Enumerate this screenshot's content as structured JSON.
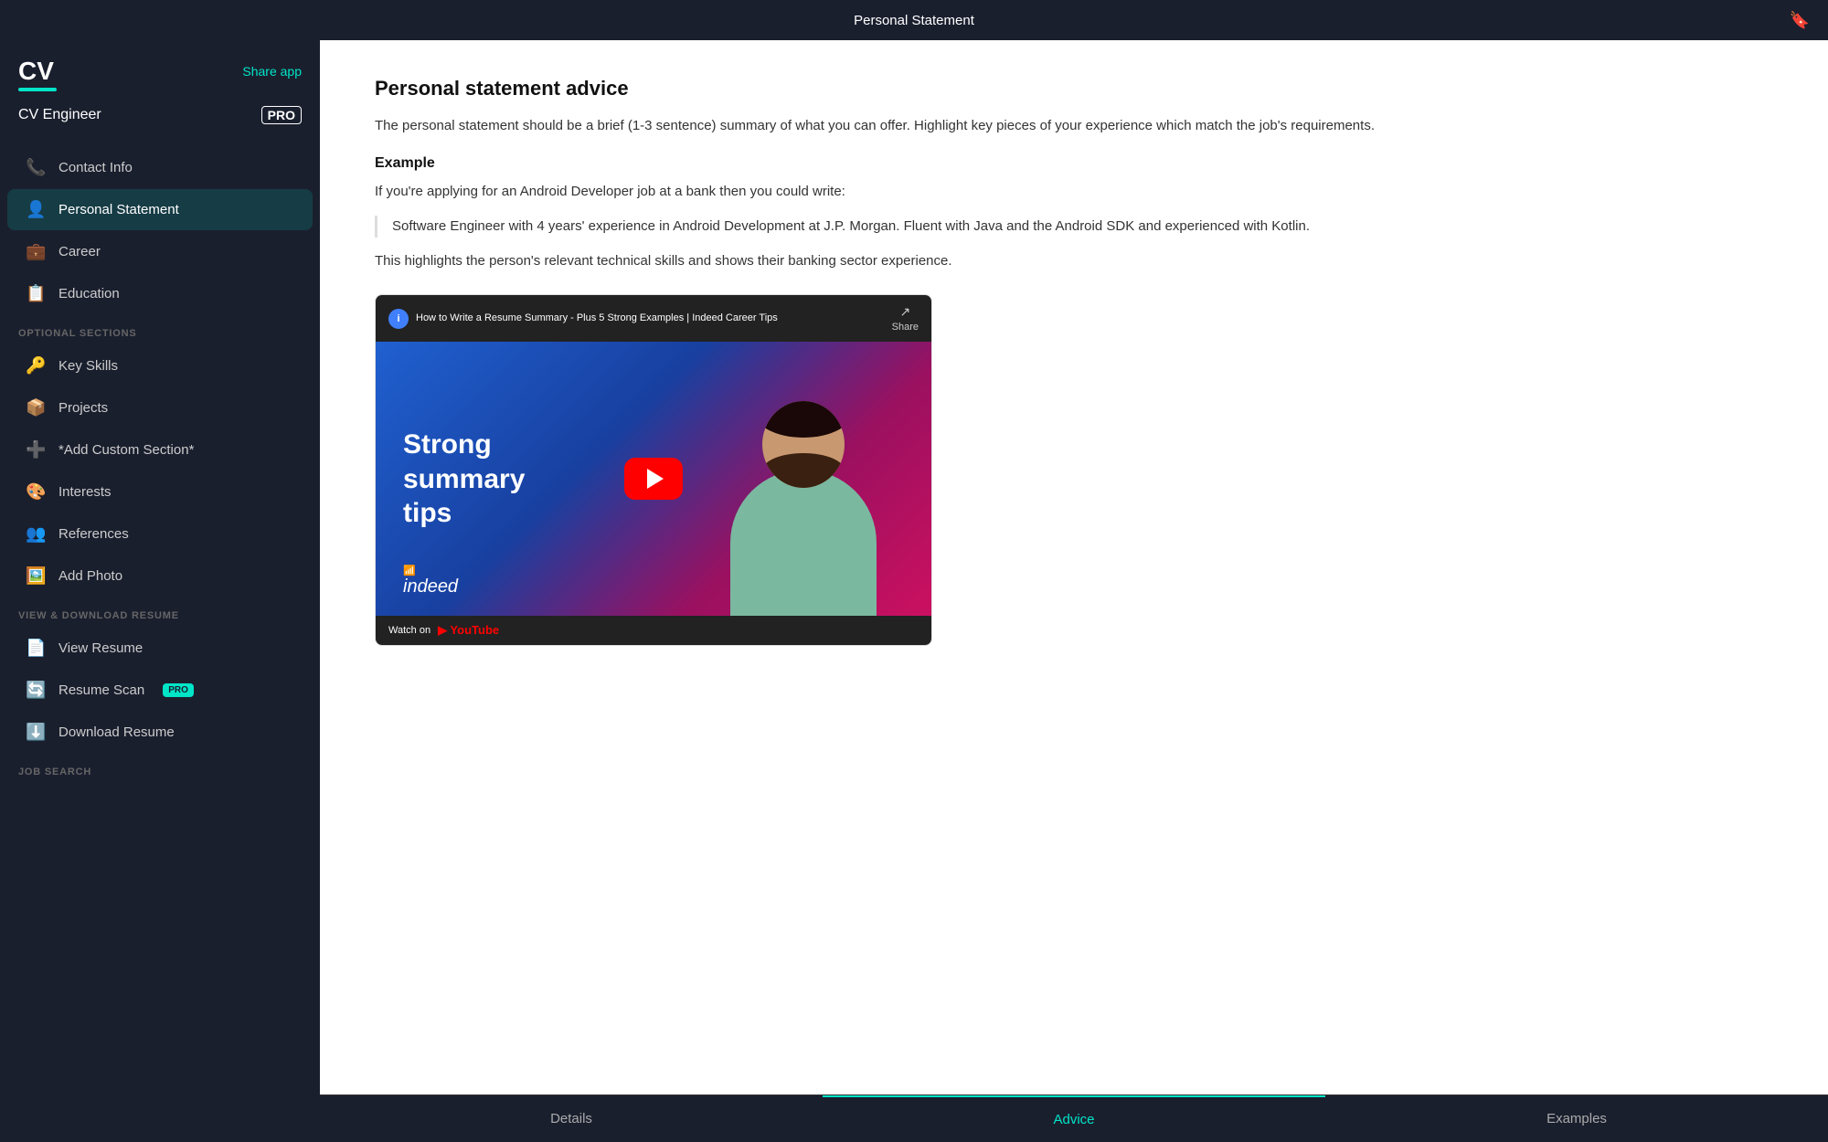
{
  "topbar": {
    "title": "Personal Statement",
    "icon": "📄"
  },
  "sidebar": {
    "logo": "CV",
    "logo_bar_color": "#00e5c8",
    "share_app_label": "Share app",
    "app_name": "CV Engineer",
    "pro_label": "PRO",
    "nav_items": [
      {
        "id": "contact-info",
        "icon": "📞",
        "label": "Contact Info",
        "active": false
      },
      {
        "id": "personal-statement",
        "icon": "👤",
        "label": "Personal Statement",
        "active": true
      },
      {
        "id": "career",
        "icon": "💼",
        "label": "Career",
        "active": false
      },
      {
        "id": "education",
        "icon": "📋",
        "label": "Education",
        "active": false
      }
    ],
    "optional_section_label": "OPTIONAL SECTIONS",
    "optional_items": [
      {
        "id": "key-skills",
        "icon": "🔑",
        "label": "Key Skills"
      },
      {
        "id": "projects",
        "icon": "📦",
        "label": "Projects"
      },
      {
        "id": "add-custom",
        "icon": "➕",
        "label": "*Add Custom Section*"
      },
      {
        "id": "interests",
        "icon": "🎨",
        "label": "Interests"
      },
      {
        "id": "references",
        "icon": "👥",
        "label": "References"
      },
      {
        "id": "add-photo",
        "icon": "🖼️",
        "label": "Add Photo"
      }
    ],
    "view_download_label": "VIEW & DOWNLOAD RESUME",
    "view_items": [
      {
        "id": "view-resume",
        "icon": "📄",
        "label": "View Resume"
      },
      {
        "id": "resume-scan",
        "icon": "🔄",
        "label": "Resume Scan",
        "pro": true
      },
      {
        "id": "download-resume",
        "icon": "⬇️",
        "label": "Download Resume"
      }
    ],
    "job_search_label": "JOB SEARCH"
  },
  "content": {
    "advice_title": "Personal statement advice",
    "advice_body": "The personal statement should be a brief (1-3 sentence) summary of what you can offer. Highlight key pieces of your experience which match the job's requirements.",
    "example_label": "Example",
    "example_text": "If you're applying for an Android Developer job at a bank then you could write:",
    "quote_text": "Software Engineer with 4 years' experience in Android Development at J.P. Morgan. Fluent with Java and the Android SDK and experienced with Kotlin.",
    "highlight_text": "This highlights the person's relevant technical skills and shows their banking sector experience.",
    "video": {
      "info_icon": "i",
      "title": "How to Write a Resume Summary - Plus 5 Strong Examples | Indeed Career Tips",
      "share_label": "Share",
      "thumbnail_text": "Strong\nsummary\ntips",
      "watch_on": "Watch on",
      "youtube": "▶ YouTube",
      "indeed_text": "indeed"
    }
  },
  "bottom_tabs": [
    {
      "id": "details",
      "label": "Details",
      "active": false
    },
    {
      "id": "advice",
      "label": "Advice",
      "active": true
    },
    {
      "id": "examples",
      "label": "Examples",
      "active": false
    }
  ]
}
